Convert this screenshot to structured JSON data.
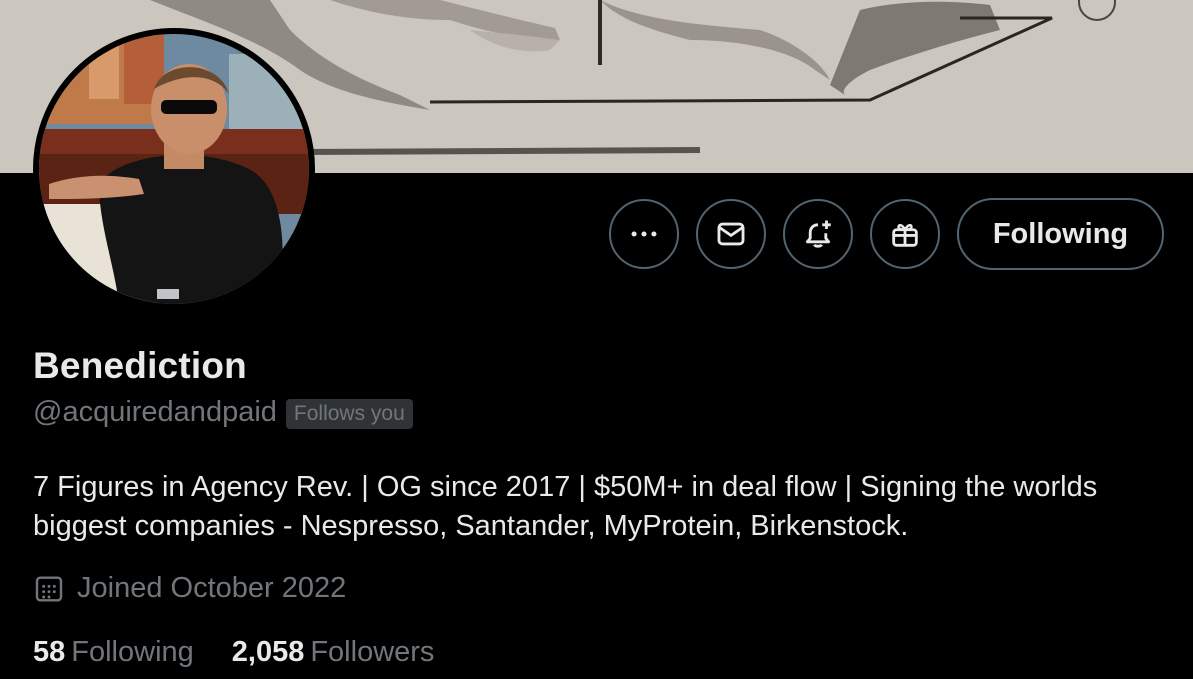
{
  "profile": {
    "name": "Benediction",
    "handle": "@acquiredandpaid",
    "follows_you": "Follows you",
    "bio": "7 Figures in Agency Rev. | OG since 2017 | $50M+ in deal flow | Signing the worlds biggest companies - Nespresso, Santander, MyProtein, Birkenstock.",
    "joined": "Joined October 2022"
  },
  "actions": {
    "more_icon": "more-dots-icon",
    "message_icon": "envelope-icon",
    "notify_icon": "bell-plus-icon",
    "gift_icon": "gift-icon",
    "follow_label": "Following"
  },
  "stats": {
    "following_count": "58",
    "following_label": "Following",
    "followers_count": "2,058",
    "followers_label": "Followers"
  },
  "colors": {
    "background": "#000000",
    "primary_text": "#e7e9ea",
    "secondary_text": "#71767b",
    "button_border": "#536471",
    "badge_bg": "#2f3336"
  }
}
